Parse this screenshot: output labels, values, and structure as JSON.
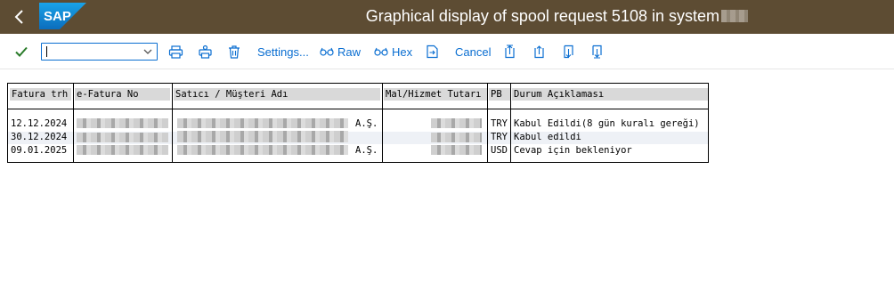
{
  "titlebar": {
    "logo_text": "SAP",
    "title": "Graphical display of spool request 5108 in system"
  },
  "toolbar": {
    "command_field_value": "",
    "settings_label": "Settings...",
    "raw_label": "Raw",
    "hex_label": "Hex",
    "cancel_label": "Cancel"
  },
  "table": {
    "headers": [
      "Fatura trh",
      "e-Fatura No",
      "Satıcı / Müşteri Adı",
      "Mal/Hizmet Tutarı",
      "PB",
      "Durum Açıklaması"
    ],
    "rows": [
      {
        "date": "12.12.2024",
        "name_suffix": "A.Ş.",
        "currency": "TRY",
        "status": "Kabul Edildi(8 gün kuralı gereği)"
      },
      {
        "date": "30.12.2024",
        "name_suffix": "",
        "currency": "TRY",
        "status": "Kabul edildi"
      },
      {
        "date": "09.01.2025",
        "name_suffix": "A.Ş.",
        "currency": "USD",
        "status": "Cevap için bekleniyor"
      }
    ]
  },
  "colors": {
    "titlebar": "#5d4c33",
    "accent": "#0a6ed1",
    "check": "#2b7c2b"
  }
}
